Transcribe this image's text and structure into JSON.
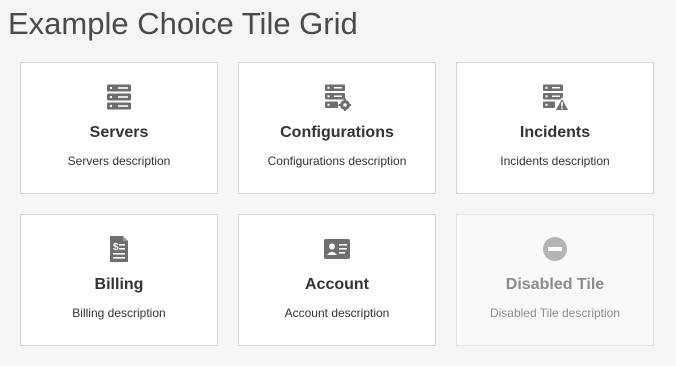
{
  "page": {
    "title": "Example Choice Tile Grid"
  },
  "colors": {
    "icon": "#6f6f6f",
    "icon_disabled": "#b4b4b4",
    "tile_border": "#d7d7d7",
    "background": "#f5f5f5"
  },
  "tiles": [
    {
      "title": "Servers",
      "description": "Servers description",
      "icon": "server-stack-icon",
      "disabled": false
    },
    {
      "title": "Configurations",
      "description": "Configurations description",
      "icon": "server-gear-icon",
      "disabled": false
    },
    {
      "title": "Incidents",
      "description": "Incidents description",
      "icon": "server-warning-icon",
      "disabled": false
    },
    {
      "title": "Billing",
      "description": "Billing description",
      "icon": "billing-document-icon",
      "disabled": false
    },
    {
      "title": "Account",
      "description": "Account description",
      "icon": "account-card-icon",
      "disabled": false
    },
    {
      "title": "Disabled Tile",
      "description": "Disabled Tile description",
      "icon": "disabled-circle-icon",
      "disabled": true
    }
  ]
}
